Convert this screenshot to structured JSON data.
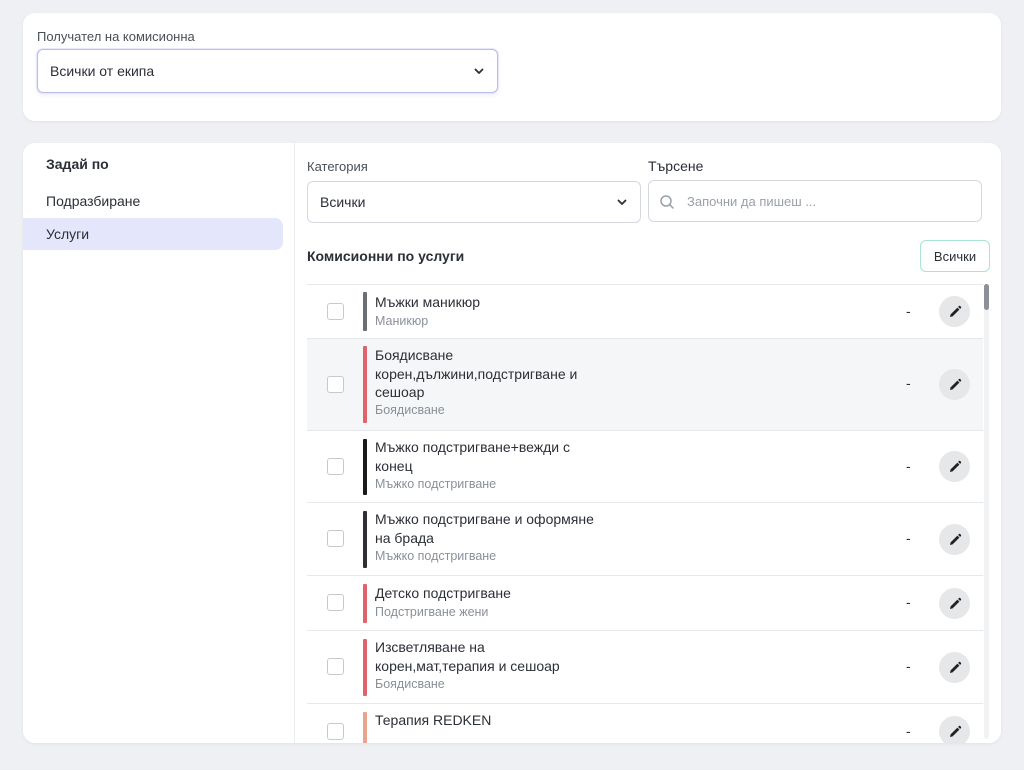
{
  "recipient": {
    "label": "Получател на комисионна",
    "value": "Всички от екипа"
  },
  "sidebar": {
    "title": "Задай по",
    "items": [
      {
        "label": "Подразбиране",
        "active": false
      },
      {
        "label": "Услуги",
        "active": true
      }
    ]
  },
  "filters": {
    "category_label": "Категория",
    "category_value": "Всички",
    "search_label": "Търсене",
    "search_placeholder": "Започни да пишеш ..."
  },
  "services_section": {
    "title": "Комисионни по услуги",
    "all_button": "Всички"
  },
  "services": [
    {
      "name": "Мъжки маникюр",
      "category": "Маникюр",
      "value": "-",
      "color": "#6b6e73"
    },
    {
      "name": "Боядисване корен,дължини,подстригване и сешоар",
      "category": "Боядисване",
      "value": "-",
      "color": "#e0626a"
    },
    {
      "name": "Мъжко подстригване+вежди с конец",
      "category": "Мъжко подстригване",
      "value": "-",
      "color": "#1a1a1a"
    },
    {
      "name": "Мъжко подстригване и оформяне на брада",
      "category": "Мъжко подстригване",
      "value": "-",
      "color": "#2e3034"
    },
    {
      "name": "Детско подстригване",
      "category": "Подстригване жени",
      "value": "-",
      "color": "#e0626a"
    },
    {
      "name": "Изсветляване на корен,мат,терапия и сешоар",
      "category": "Боядисване",
      "value": "-",
      "color": "#e0626a"
    },
    {
      "name": "Терапия REDKEN",
      "category": "",
      "value": "-",
      "color": "#e8a58c"
    }
  ]
}
